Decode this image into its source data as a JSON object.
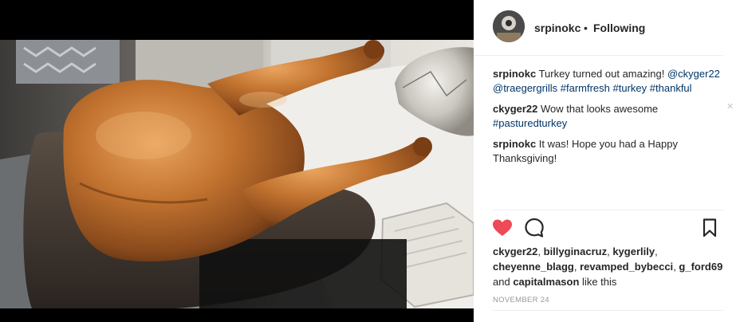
{
  "header": {
    "username": "srpinokc",
    "separator": "•",
    "follow_status": "Following",
    "avatar_icon": "profile-avatar"
  },
  "comments": [
    {
      "user": "srpinokc",
      "text": " Turkey turned out amazing! ",
      "mentions": [
        "@ckyger22",
        "@traegergrills"
      ],
      "hashtags": [
        "#farmfresh",
        "#turkey",
        "#thankful"
      ]
    },
    {
      "user": "ckyger22",
      "text": " Wow that looks awesome ",
      "hashtags": [
        "#pasturedturkey"
      ],
      "delete_icon": "×"
    },
    {
      "user": "srpinokc",
      "text": " It was! Hope you had a Happy Thanksgiving!"
    }
  ],
  "actions": {
    "like_icon": "heart-icon",
    "comment_icon": "comment-icon",
    "save_icon": "bookmark-icon",
    "like_color": "#ed4956"
  },
  "likes": {
    "names": [
      "ckyger22",
      "billyginacruz",
      "kygerlily",
      "cheyenne_blagg",
      "revamped_bybecci",
      "g_ford69"
    ],
    "last": "capitalmason",
    "and_word": "and",
    "suffix": "like this"
  },
  "date": "NOVEMBER 24",
  "colors": {
    "text": "#262626",
    "link": "#003569",
    "muted": "#999999",
    "border": "#efefef"
  }
}
